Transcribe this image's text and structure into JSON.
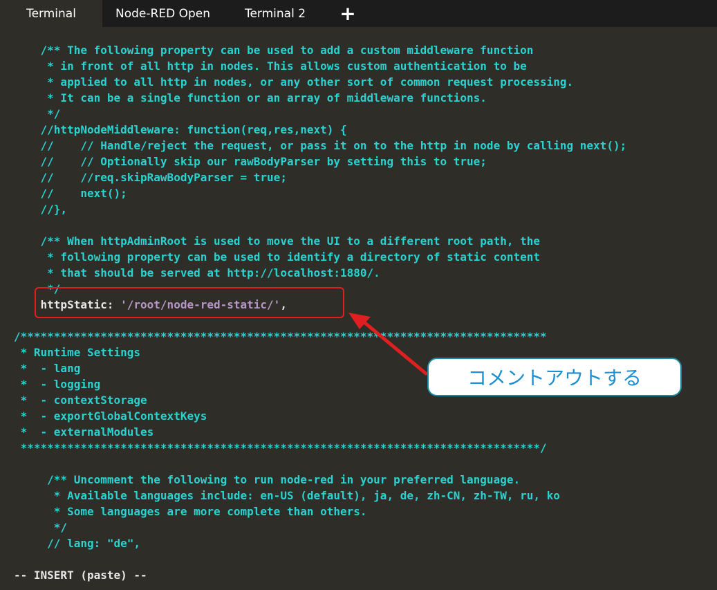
{
  "tabs": [
    {
      "label": "Terminal",
      "active": true
    },
    {
      "label": "Node-RED Open",
      "active": false
    },
    {
      "label": "Terminal 2",
      "active": false
    }
  ],
  "add_tab_label": "+",
  "editor": {
    "lines": [
      {
        "parts": [
          {
            "t": "    /** The following property can be used to add a custom middleware function",
            "c": "comment"
          }
        ]
      },
      {
        "parts": [
          {
            "t": "     * in front of all http in nodes. This allows custom authentication to be",
            "c": "comment"
          }
        ]
      },
      {
        "parts": [
          {
            "t": "     * applied to all http in nodes, or any other sort of common request processing.",
            "c": "comment"
          }
        ]
      },
      {
        "parts": [
          {
            "t": "     * It can be a single function or an array of middleware functions.",
            "c": "comment"
          }
        ]
      },
      {
        "parts": [
          {
            "t": "     */",
            "c": "comment"
          }
        ]
      },
      {
        "parts": [
          {
            "t": "    //httpNodeMiddleware: function(req,res,next) {",
            "c": "comment"
          }
        ]
      },
      {
        "parts": [
          {
            "t": "    //    // Handle/reject the request, or pass it on to the http in node by calling next();",
            "c": "comment"
          }
        ]
      },
      {
        "parts": [
          {
            "t": "    //    // Optionally skip our rawBodyParser by setting this to true;",
            "c": "comment"
          }
        ]
      },
      {
        "parts": [
          {
            "t": "    //    //req.skipRawBodyParser = true;",
            "c": "comment"
          }
        ]
      },
      {
        "parts": [
          {
            "t": "    //    next();",
            "c": "comment"
          }
        ]
      },
      {
        "parts": [
          {
            "t": "    //},",
            "c": "comment"
          }
        ]
      },
      {
        "parts": [
          {
            "t": "",
            "c": "comment"
          }
        ]
      },
      {
        "parts": [
          {
            "t": "    /** When httpAdminRoot is used to move the UI to a different root path, the",
            "c": "comment"
          }
        ]
      },
      {
        "parts": [
          {
            "t": "     * following property can be used to identify a directory of static content",
            "c": "comment"
          }
        ]
      },
      {
        "parts": [
          {
            "t": "     * that should be served at http://localhost:1880/.",
            "c": "comment"
          }
        ]
      },
      {
        "parts": [
          {
            "t": "     */",
            "c": "comment"
          }
        ]
      },
      {
        "parts": [
          {
            "t": "    httpStatic: ",
            "c": "white"
          },
          {
            "t": "'/root/node-red-static/'",
            "c": "string"
          },
          {
            "t": ",",
            "c": "white"
          }
        ]
      },
      {
        "parts": [
          {
            "t": "",
            "c": "comment"
          }
        ]
      },
      {
        "parts": [
          {
            "t": "/*******************************************************************************",
            "c": "comment"
          }
        ]
      },
      {
        "parts": [
          {
            "t": " * Runtime Settings",
            "c": "comment"
          }
        ]
      },
      {
        "parts": [
          {
            "t": " *  - lang",
            "c": "comment"
          }
        ]
      },
      {
        "parts": [
          {
            "t": " *  - logging",
            "c": "comment"
          }
        ]
      },
      {
        "parts": [
          {
            "t": " *  - contextStorage",
            "c": "comment"
          }
        ]
      },
      {
        "parts": [
          {
            "t": " *  - exportGlobalContextKeys",
            "c": "comment"
          }
        ]
      },
      {
        "parts": [
          {
            "t": " *  - externalModules",
            "c": "comment"
          }
        ]
      },
      {
        "parts": [
          {
            "t": " ******************************************************************************/",
            "c": "comment"
          }
        ]
      },
      {
        "parts": [
          {
            "t": "",
            "c": "comment"
          }
        ]
      },
      {
        "parts": [
          {
            "t": "     /** Uncomment the following to run node-red in your preferred language.",
            "c": "comment"
          }
        ]
      },
      {
        "parts": [
          {
            "t": "      * Available languages include: en-US (default), ja, de, zh-CN, zh-TW, ru, ko",
            "c": "comment"
          }
        ]
      },
      {
        "parts": [
          {
            "t": "      * Some languages are more complete than others.",
            "c": "comment"
          }
        ]
      },
      {
        "parts": [
          {
            "t": "      */",
            "c": "comment"
          }
        ]
      },
      {
        "parts": [
          {
            "t": "     // lang: \"de\",",
            "c": "comment"
          }
        ]
      },
      {
        "parts": [
          {
            "t": "",
            "c": "comment"
          }
        ]
      },
      {
        "parts": [
          {
            "t": "-- INSERT (paste) --",
            "c": "white"
          }
        ]
      }
    ]
  },
  "annotation": {
    "callout_text": "コメントアウトする",
    "box_color": "#e02020",
    "callout_text_color": "#1e8fd0"
  },
  "colors": {
    "background": "#2e2d28",
    "tabbar": "#1c1c1c",
    "comment": "#2ad2d0",
    "string": "#b896c8",
    "text": "#e8e8e8"
  }
}
